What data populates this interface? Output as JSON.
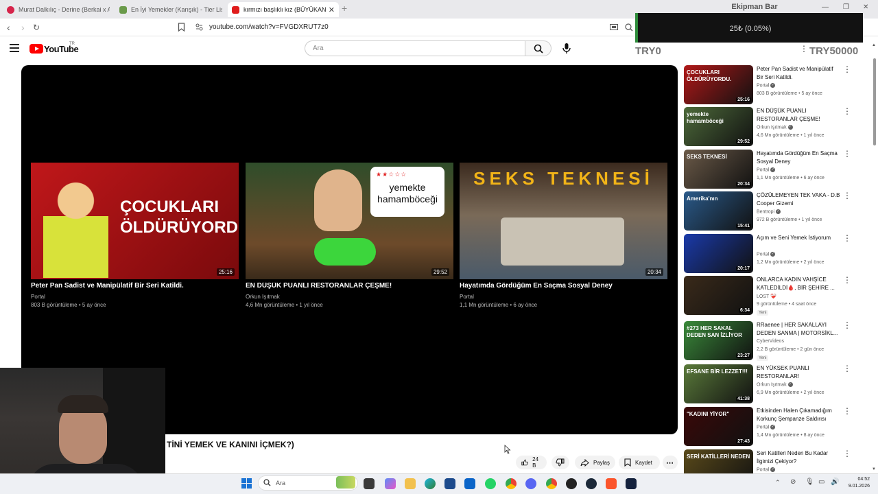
{
  "browser": {
    "tabs": [
      {
        "title": "Murat Dalkılıç - Derine (Berkai x ATH",
        "favicon_color": "#d6244b"
      },
      {
        "title": "En İyi Yemekler (Karışık) - Tier List, K",
        "favicon_color": "#6a9a4a"
      },
      {
        "title": "kırmızı başlıklı kız (BÜYÜKANNE",
        "favicon_color": "#e01d1d"
      }
    ],
    "new_tab_glyph": "+",
    "url": "youtube.com/watch?v=FVGDXRUT7z0"
  },
  "overlay": {
    "title": "Ekipman Bar",
    "value": "25₺ (0.05%)",
    "progress_percent": 0.05,
    "goal_start": "TRY0",
    "goal_end": "TRY50000"
  },
  "youtube": {
    "logo_text": "YouTube",
    "country_code": "TR",
    "search_placeholder": "Ara",
    "brand_color": "#ff0000"
  },
  "endscreen": [
    {
      "title": "Peter Pan Sadist ve Manipülatif Bir Seri Katildi.",
      "channel": "Portal",
      "meta": "803 B görüntüleme • 5 ay önce",
      "duration": "25:16",
      "overlay_text": "ÇOCUKLARI\nÖLDÜRÜYORDU."
    },
    {
      "title": "EN DÜŞÜK PUANLI RESTORANLAR ÇEŞME!",
      "channel": "Orkun Işıtmak",
      "meta": "4,6 Mn görüntüleme • 1 yıl önce",
      "duration": "29:52",
      "overlay_text": "yemekte\nhamamböceği"
    },
    {
      "title": "Hayatımda Gördüğüm En Saçma Sosyal Deney",
      "channel": "Portal",
      "meta": "1,1 Mn görüntüleme • 6 ay önce",
      "duration": "20:34",
      "overlay_text": "SEKS TEKNESİ"
    }
  ],
  "video": {
    "title": "TİNİ YEMEK VE KANINI İÇMEK?)",
    "like_count": "24 B",
    "share_label": "Paylaş",
    "save_label": "Kaydet"
  },
  "sidebar": [
    {
      "title": "Peter Pan Sadist ve Manipülatif Bir Seri Katildi.",
      "channel": "Portal",
      "meta": "803 B görüntüleme • 5 ay önce",
      "duration": "25:16",
      "verified": true,
      "new": false,
      "thumb_text": "ÇOCUKLARI\nÖLDÜRÜYORDU.",
      "thumb_color": "#b01818"
    },
    {
      "title": "EN DÜŞÜK PUANLI RESTORANLAR ÇEŞME!",
      "channel": "Orkun Işıtmak",
      "meta": "4,6 Mn görüntüleme • 1 yıl önce",
      "duration": "29:52",
      "verified": true,
      "new": false,
      "thumb_text": "yemekte\nhamamböceği",
      "thumb_color": "#4d6a3a"
    },
    {
      "title": "Hayatımda Gördüğüm En Saçma Sosyal Deney",
      "channel": "Portal",
      "meta": "1,1 Mn görüntüleme • 6 ay önce",
      "duration": "20:34",
      "verified": true,
      "new": false,
      "thumb_text": "SEKS TEKNESİ",
      "thumb_color": "#6b5a48"
    },
    {
      "title": "ÇÖZÜLEMEYEN TEK VAKA - D.B Cooper Gizemi",
      "channel": "Bentropi",
      "meta": "972 B görüntüleme • 1 yıl önce",
      "duration": "15:41",
      "verified": true,
      "new": false,
      "thumb_text": "Amerika'nın",
      "thumb_color": "#2a5a8a"
    },
    {
      "title": "Açım ve Seni Yemek İstiyorum",
      "channel": "Portal",
      "meta": "1,2 Mn görüntüleme • 2 yıl önce",
      "duration": "20:17",
      "verified": true,
      "new": false,
      "thumb_text": "",
      "thumb_color": "#1a3aaa"
    },
    {
      "title": "ONLARCA KADIN VAHŞİCE KATLEDİLDİ🩸, BİR ŞEHİRE ...",
      "channel": "LOST ❤‍🩹",
      "meta": "9 görüntüleme • 4 saat önce",
      "duration": "6:34",
      "verified": false,
      "new": true,
      "new_label": "Yeni",
      "thumb_text": "",
      "thumb_color": "#3a2a1a"
    },
    {
      "title": "RRaenee | HER SAKALLAYI DEDEN SANMA | MOTORSİKL...",
      "channel": "CyberVideos",
      "meta": "2,2 B görüntüleme • 2 gün önce",
      "duration": "23:27",
      "verified": false,
      "new": true,
      "new_label": "Yeni",
      "thumb_text": "#273 HER SAKAL DEDEN SAN İZLİYOR",
      "thumb_color": "#3a8a3a"
    },
    {
      "title": "EN YÜKSEK PUANLI RESTORANLAR!",
      "channel": "Orkun Işıtmak",
      "meta": "6,9 Mn görüntüleme • 2 yıl önce",
      "duration": "41:38",
      "verified": true,
      "new": false,
      "thumb_text": "EFSANE BİR LEZZET!!!",
      "thumb_color": "#5a7a3a"
    },
    {
      "title": "Etkisinden Halen Çıkamadığım Korkunç Şempanze Saldırısı",
      "channel": "Portal",
      "meta": "1,4 Mn görüntüleme • 8 ay önce",
      "duration": "27:43",
      "verified": true,
      "new": false,
      "thumb_text": "\"KADINI YİYOR\"",
      "thumb_color": "#3a0808"
    },
    {
      "title": "Seri Katilleri Neden Bu Kadar İlgimizi Çekiyor?",
      "channel": "Portal",
      "meta": "",
      "duration": "",
      "verified": true,
      "new": false,
      "thumb_text": "SERİ KATİLLERİ NEDEN",
      "thumb_color": "#5a4a1a"
    }
  ],
  "taskbar": {
    "search_placeholder": "Ara",
    "time": "04:52",
    "date": "9.01.2026"
  }
}
